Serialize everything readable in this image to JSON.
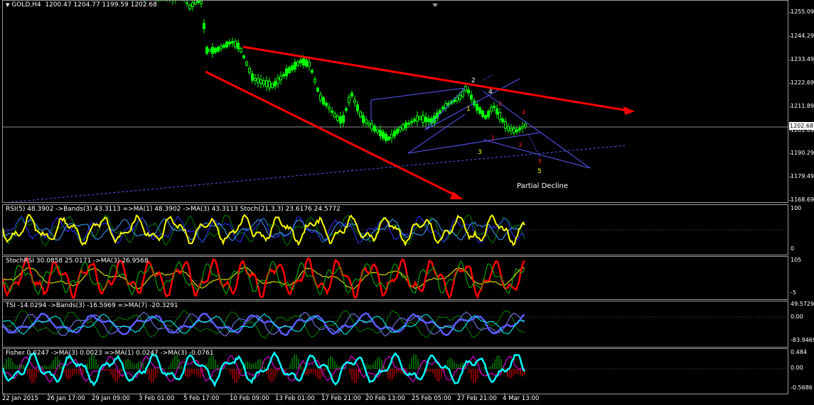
{
  "symbol_label": "GOLD,H4",
  "ohlc": "1200.47 1204.77 1199.59 1202.68",
  "current_price": "1202.68",
  "price_scale": [
    "1255.09",
    "1244.29",
    "1233.49",
    "1222.69",
    "1211.89",
    "1201.09",
    "1190.29",
    "1179.49",
    "1168.69"
  ],
  "wave_labels": {
    "a1": "1",
    "a2": "2",
    "a3": "3",
    "a4": "4",
    "a5": "5",
    "b1": "1",
    "b2": "2",
    "b3": "3",
    "b4": "4",
    "b5": "5"
  },
  "partial_decline_text": "Partial Decline",
  "indicators": {
    "rsi": {
      "title": "RSI(5) 48.3902  ->Bands(3) 43.3113  =>MA(1) 48.3902  ->MA(3) 43.3113  Stoch(21,3,3) 23.6176 24.5772",
      "scale": [
        "100",
        "0"
      ]
    },
    "stochrsi": {
      "title": "StochRSI 30.0858 25.0171  ->MA(3) 26.9568",
      "scale": [
        "105",
        "-5"
      ]
    },
    "tsi": {
      "title": "TSI -14.0294  ->Bands(3) -16.5969  =>MA(7) -20.3291",
      "scale": [
        "49.5729",
        "0.00",
        "-83.9469"
      ]
    },
    "fisher": {
      "title": "Fisher 0.0247  ->MA(3) 0.0023  =>MA(1) 0.0247  ->MA(3) -0.0761",
      "scale": [
        "0.484",
        "0.00",
        "-0.5686"
      ]
    }
  },
  "time_axis": [
    "22 Jan 2015",
    "26 Jan 17:00",
    "29 Jan 09:00",
    "3 Feb 01:00",
    "5 Feb 17:00",
    "10 Feb 09:00",
    "13 Feb 01:00",
    "17 Feb 21:00",
    "20 Feb 13:00",
    "25 Feb 05:00",
    "27 Feb 21:00",
    "4 Mar 13:00"
  ],
  "colors": {
    "candle": "#00ff00",
    "trendline": "#ff0000",
    "channel": "#5a5aff",
    "rsi_main": "#ffff00",
    "stochrsi_main": "#ff0000",
    "tsi_main": "#5a5aff",
    "fisher_main": "#00ffff"
  }
}
